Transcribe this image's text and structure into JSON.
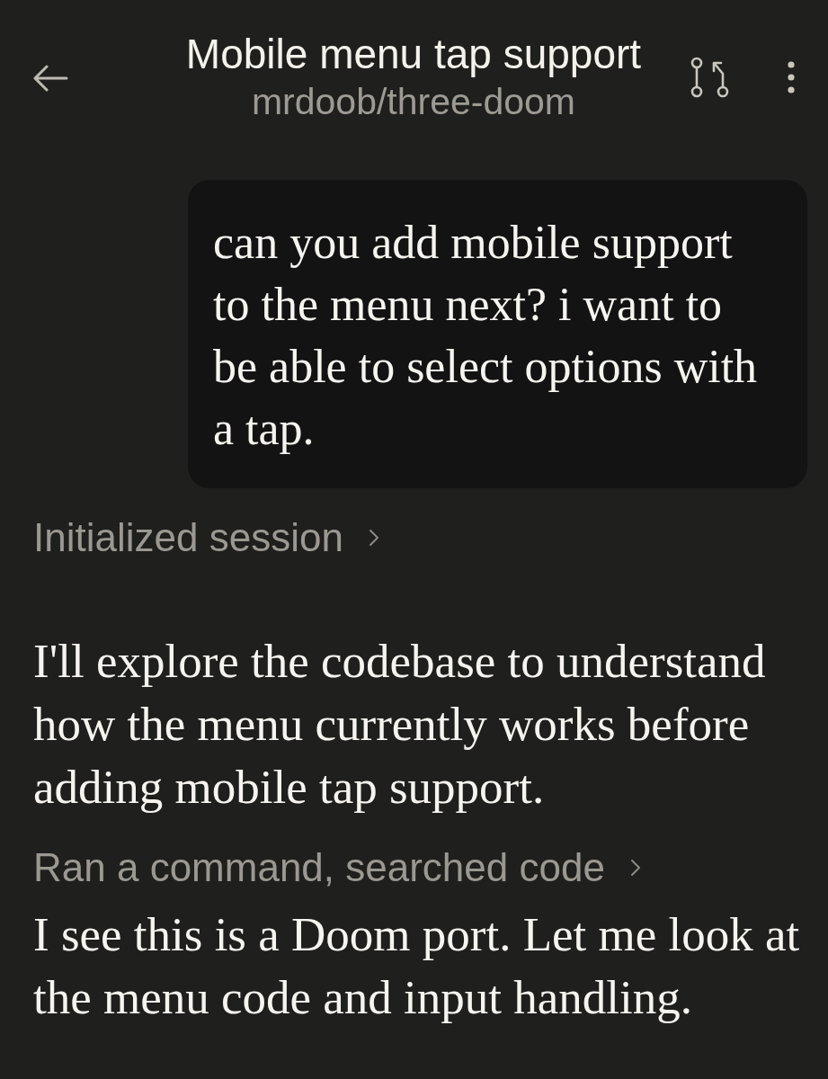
{
  "header": {
    "title": "Mobile menu tap support",
    "subtitle": "mrdoob/three-doom"
  },
  "messages": [
    {
      "kind": "user",
      "text": "can you add mobile support to the menu next? i want to be able to select options with a tap."
    },
    {
      "kind": "activity",
      "text": "Initialized session",
      "expanded": false
    },
    {
      "kind": "assistant",
      "text": "I'll explore the codebase to understand how the menu currently works before adding mobile tap support."
    },
    {
      "kind": "activity",
      "text": "Ran a command, searched code",
      "expanded": false
    },
    {
      "kind": "assistant",
      "text": "I see this is a Doom port. Let me look at the menu code and input handling."
    }
  ]
}
